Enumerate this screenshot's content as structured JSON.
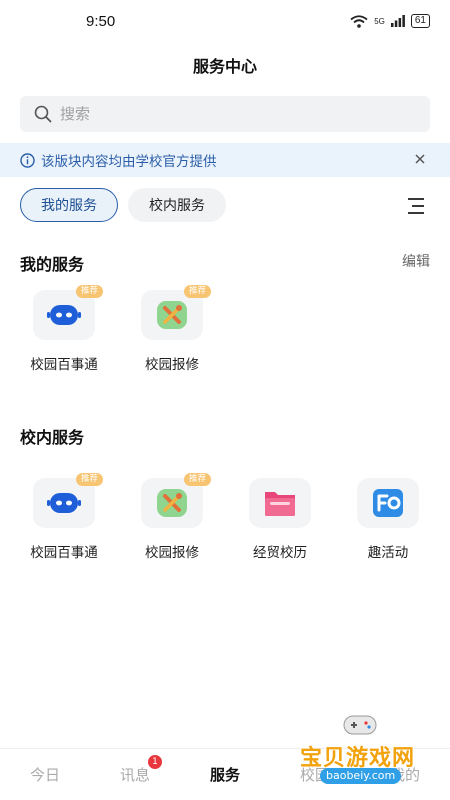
{
  "status": {
    "time": "9:50",
    "network": "5G",
    "battery": "61"
  },
  "header": {
    "title": "服务中心"
  },
  "search": {
    "placeholder": "搜索"
  },
  "notice": {
    "text": "该版块内容均由学校官方提供"
  },
  "tabs": [
    {
      "label": "我的服务",
      "active": true
    },
    {
      "label": "校内服务",
      "active": false
    }
  ],
  "my_services": {
    "title": "我的服务",
    "edit_label": "编辑",
    "items": [
      {
        "label": "校园百事通",
        "icon": "robot-icon",
        "badge": "推荐"
      },
      {
        "label": "校园报修",
        "icon": "repair-tools-icon",
        "badge": "推荐"
      }
    ]
  },
  "campus_services": {
    "title": "校内服务",
    "items": [
      {
        "label": "校园百事通",
        "icon": "robot-icon",
        "badge": "推荐"
      },
      {
        "label": "校园报修",
        "icon": "repair-tools-icon",
        "badge": "推荐"
      },
      {
        "label": "经贸校历",
        "icon": "folder-calendar-icon"
      },
      {
        "label": "趣活动",
        "icon": "fa-activity-icon"
      }
    ]
  },
  "bottom_nav": [
    {
      "label": "今日",
      "active": false
    },
    {
      "label": "讯息",
      "active": false,
      "badge": "1"
    },
    {
      "label": "服务",
      "active": true
    },
    {
      "label": "校园",
      "active": false
    },
    {
      "label": "我的",
      "active": false
    }
  ],
  "watermark": {
    "text": "宝贝游戏网",
    "url": "baobeiy.com"
  },
  "colors": {
    "accent": "#2a5ea8",
    "badge": "#f7c471",
    "notice_bg": "#eaf2fb"
  }
}
